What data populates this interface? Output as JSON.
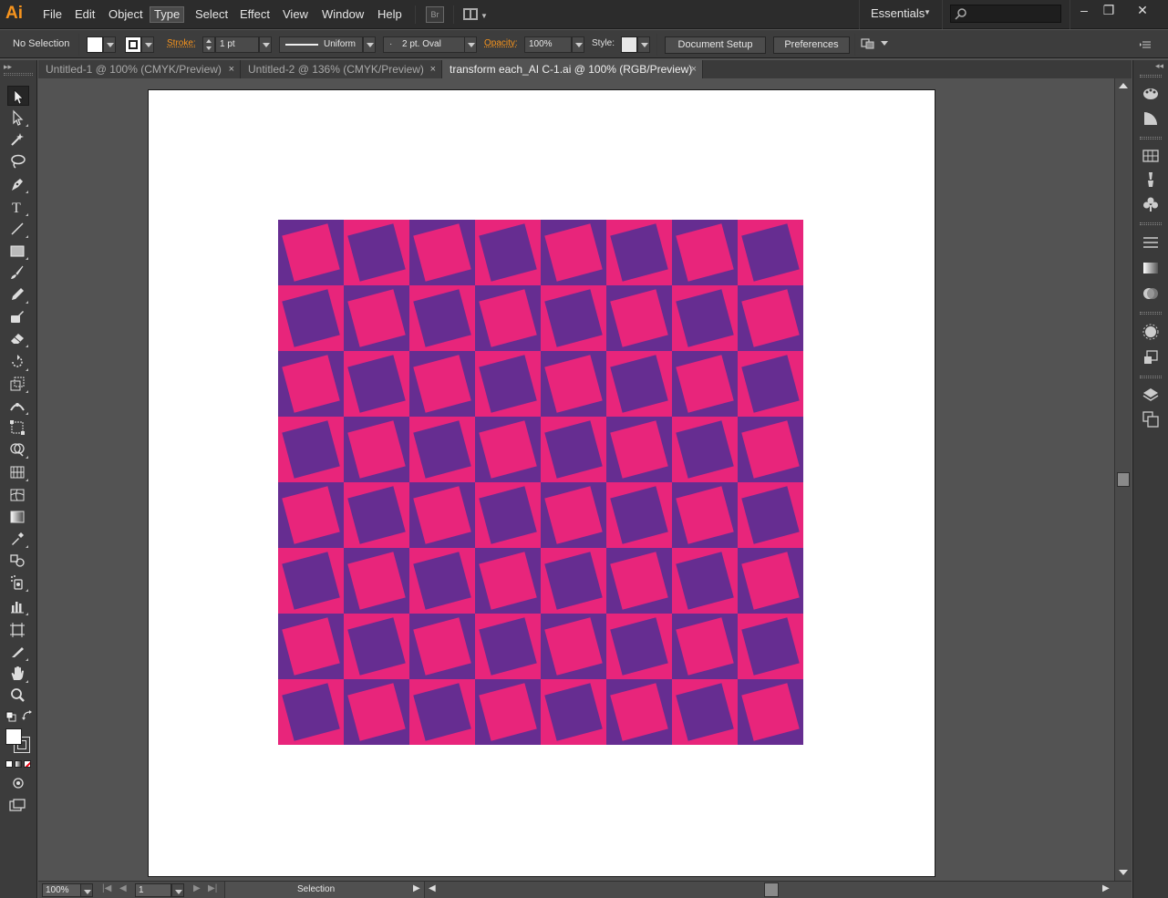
{
  "app": {
    "logo": "Ai",
    "menu": [
      "File",
      "Edit",
      "Object",
      "Type",
      "Select",
      "Effect",
      "View",
      "Window",
      "Help"
    ],
    "active_menu": "Type",
    "bridge_label": "Br",
    "workspace": "Essentials",
    "window_buttons": [
      "–",
      "❐",
      "✕"
    ]
  },
  "control_bar": {
    "selection_status": "No Selection",
    "stroke_label": "Stroke:",
    "stroke_weight": "1 pt",
    "stroke_profile": "Uniform",
    "brush": "2 pt. Oval",
    "opacity_label": "Opacity:",
    "opacity_value": "100%",
    "style_label": "Style:",
    "document_setup": "Document Setup",
    "preferences": "Preferences"
  },
  "tabs": [
    {
      "label": "Untitled-1 @ 100% (CMYK/Preview)",
      "close": "×"
    },
    {
      "label": "Untitled-2 @ 136% (CMYK/Preview)",
      "close": "×"
    },
    {
      "label": "transform each_AI C-1.ai @ 100% (RGB/Preview)",
      "close": "×",
      "active": true
    }
  ],
  "canvas": {
    "pattern_colors": {
      "pink": "#e8257b",
      "purple": "#662d91"
    },
    "grid_rows": 8,
    "grid_cols": 8,
    "square_rotation_deg": -15
  },
  "status_bar": {
    "zoom": "100%",
    "artboard_number": "1",
    "current_tool": "Selection"
  },
  "colors": {
    "brand_orange": "#f7941d",
    "fill_color": "#ffffff"
  },
  "icons": {
    "tools": [
      "selection-tool-icon",
      "direct-selection-tool-icon",
      "magic-wand-tool-icon",
      "lasso-tool-icon",
      "pen-tool-icon",
      "type-tool-icon",
      "line-segment-tool-icon",
      "rectangle-tool-icon",
      "paintbrush-tool-icon",
      "pencil-tool-icon",
      "blob-brush-tool-icon",
      "eraser-tool-icon",
      "rotate-tool-icon",
      "scale-tool-icon",
      "width-tool-icon",
      "free-transform-tool-icon",
      "shape-builder-tool-icon",
      "perspective-grid-tool-icon",
      "mesh-tool-icon",
      "gradient-tool-icon",
      "eyedropper-tool-icon",
      "blend-tool-icon",
      "symbol-sprayer-tool-icon",
      "column-graph-tool-icon",
      "artboard-tool-icon",
      "slice-tool-icon",
      "hand-tool-icon",
      "zoom-tool-icon"
    ]
  }
}
